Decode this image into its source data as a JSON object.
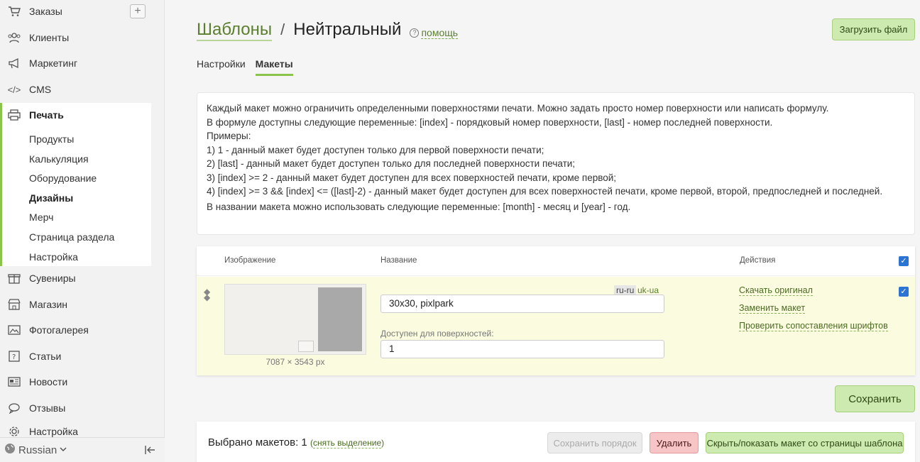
{
  "sidebar": {
    "items": [
      {
        "label": "Заказы",
        "icon": "cart-icon"
      },
      {
        "label": "Клиенты",
        "icon": "users-icon"
      },
      {
        "label": "Маркетинг",
        "icon": "megaphone-icon"
      },
      {
        "label": "CMS",
        "icon": "code-icon"
      },
      {
        "label": "Печать",
        "icon": "printer-icon"
      },
      {
        "label": "Сувениры",
        "icon": "gift-icon"
      },
      {
        "label": "Магазин",
        "icon": "shop-icon"
      },
      {
        "label": "Фотогалерея",
        "icon": "gallery-icon"
      },
      {
        "label": "Статьи",
        "icon": "article-icon"
      },
      {
        "label": "Новости",
        "icon": "news-icon"
      },
      {
        "label": "Отзывы",
        "icon": "reviews-icon"
      },
      {
        "label": "Настройка",
        "icon": "settings-icon"
      }
    ],
    "print_sub": [
      "Продукты",
      "Калькуляция",
      "Оборудование",
      "Дизайны",
      "Мерч",
      "Страница раздела",
      "Настройка"
    ],
    "plus": "+",
    "language": "Russian"
  },
  "header": {
    "breadcrumb": "Шаблоны",
    "separator": "/",
    "title": "Нейтральный",
    "help_label": "помощь",
    "upload_button": "Загрузить файл"
  },
  "tabs": [
    "Настройки",
    "Макеты"
  ],
  "info": {
    "lines": [
      "Каждый макет можно ограничить определенными поверхностями печати. Можно задать просто номер поверхности или написать формулу.",
      "В формуле доступны следующие переменные: [index] - порядковый номер поверхности, [last] - номер последней поверхности.",
      "Примеры:",
      "1) 1 - данный макет будет доступен только для первой поверхности печати;",
      "2) [last] - данный макет будет доступен только для последней поверхности печати;",
      "3) [index] >= 2 - данный макет будет доступен для всех поверхностей печати, кроме первой;",
      "4) [index] >= 3 && [index] <= ([last]-2) - данный макет будет доступен для всех поверхностей печати, кроме первой, второй, предпоследней и последней.",
      "В названии макета можно использовать следующие переменные: [month] - месяц и [year] - год."
    ]
  },
  "table": {
    "headers": {
      "image": "Изображение",
      "name": "Название",
      "actions": "Действия"
    },
    "row": {
      "dimensions": "7087 × 3543 px",
      "lang_active": "ru-ru",
      "lang_other": "uk-ua",
      "name_value": "30x30, pixlpark",
      "surfaces_label": "Доступен для поверхностей:",
      "surfaces_value": "1",
      "actions": [
        "Скачать оригинал",
        "Заменить макет",
        "Проверить сопоставления шрифтов"
      ]
    }
  },
  "save_button": "Сохранить",
  "bottom": {
    "selected_label": "Выбрано макетов: 1",
    "deselect": "снять выделение",
    "save_order": "Сохранить порядок",
    "delete": "Удалить",
    "toggle_visibility": "Скрыть/показать макет со страницы шаблона"
  },
  "colors": {
    "accent": "#8ac44a",
    "link": "#5a7f2e",
    "checkbox": "#2b74d4",
    "row_highlight": "#fbfbdf"
  }
}
